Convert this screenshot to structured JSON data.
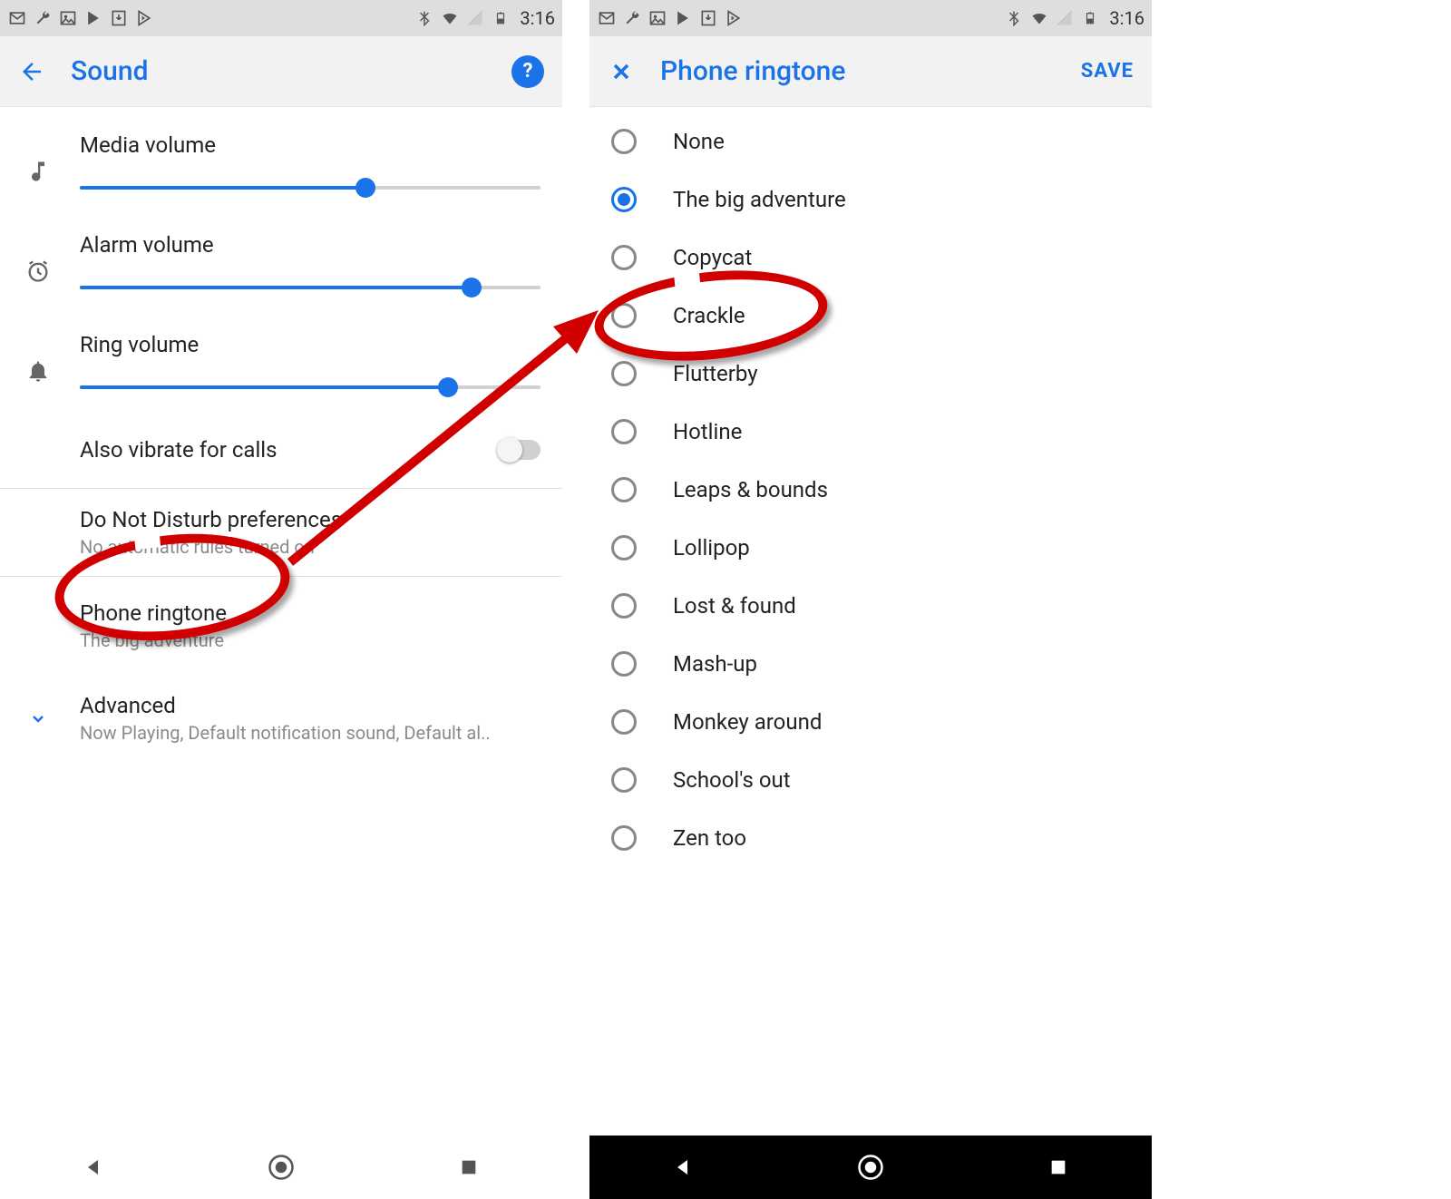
{
  "status": {
    "time": "3:16",
    "left_icons": [
      "gmail-icon",
      "wrench-icon",
      "image-icon",
      "play-store-icon",
      "download-icon",
      "play-icon"
    ],
    "right_icons": [
      "bluetooth-icon",
      "wifi-icon",
      "no-sim-icon",
      "battery-icon"
    ]
  },
  "left_screen": {
    "app_bar": {
      "title": "Sound"
    },
    "sliders": [
      {
        "label": "Media volume",
        "percent": 62,
        "icon": "music-note-icon"
      },
      {
        "label": "Alarm volume",
        "percent": 85,
        "icon": "alarm-icon"
      },
      {
        "label": "Ring volume",
        "percent": 80,
        "icon": "bell-icon"
      }
    ],
    "vibrate": {
      "label": "Also vibrate for calls",
      "on": false
    },
    "dnd": {
      "title": "Do Not Disturb preferences",
      "sub": "No automatic rules turned on"
    },
    "ringtone": {
      "title": "Phone ringtone",
      "sub": "The big adventure"
    },
    "advanced": {
      "title": "Advanced",
      "sub": "Now Playing, Default notification sound, Default al.."
    }
  },
  "right_screen": {
    "app_bar": {
      "title": "Phone ringtone",
      "save": "SAVE"
    },
    "selected_index": 1,
    "items": [
      "None",
      "The big adventure",
      "Copycat",
      "Crackle",
      "Flutterby",
      "Hotline",
      "Leaps & bounds",
      "Lollipop",
      "Lost & found",
      "Mash-up",
      "Monkey around",
      "School's out",
      "Zen too"
    ]
  },
  "annotations": {
    "circle_left": {
      "targets": "phone-ringtone-row"
    },
    "circle_right": {
      "targets": "ringtone-crackle"
    },
    "arrow": "from-left-ringtone-to-right-crackle"
  }
}
